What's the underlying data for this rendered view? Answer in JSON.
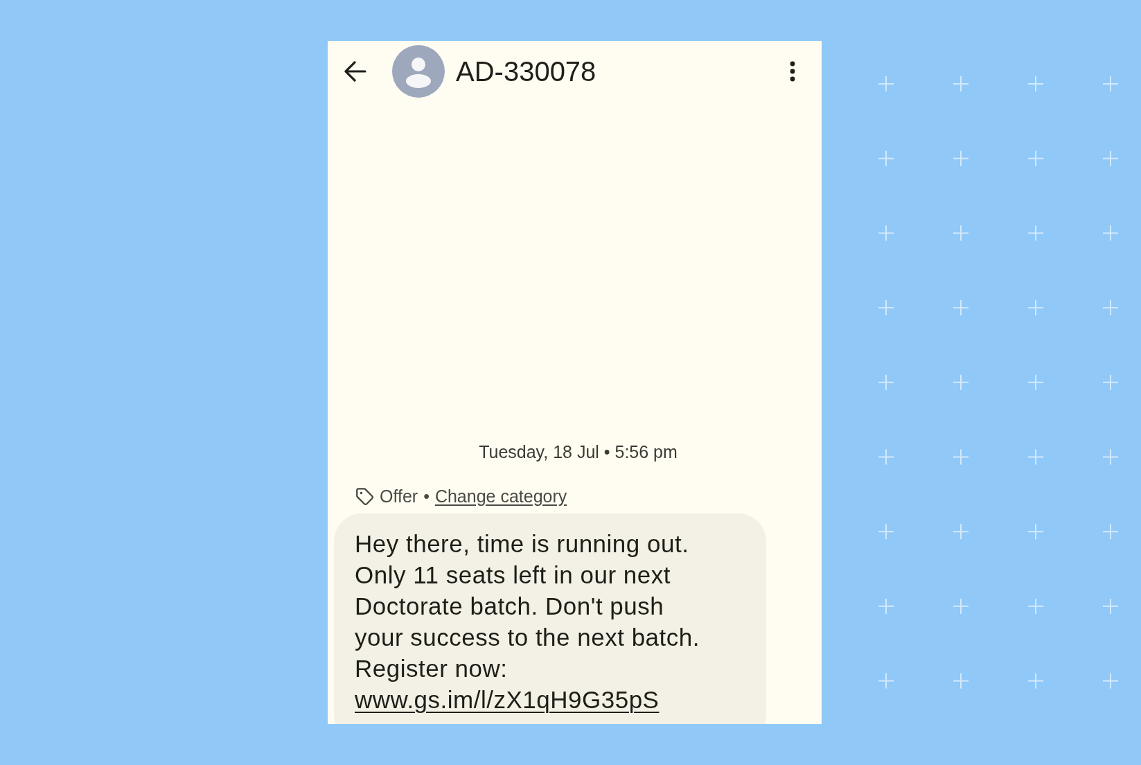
{
  "header": {
    "title": "AD-330078"
  },
  "thread": {
    "timestamp": "Tuesday, 18 Jul • 5:56 pm",
    "category": {
      "label": "Offer",
      "separator": "•",
      "link": "Change category"
    },
    "messages": [
      {
        "text": "Hey there, time is running out. Only 11 seats left in our next Doctorate batch. Don't push your success to the next batch. Register now:",
        "link": "www.gs.im/l/zX1qH9G35pS"
      }
    ]
  }
}
